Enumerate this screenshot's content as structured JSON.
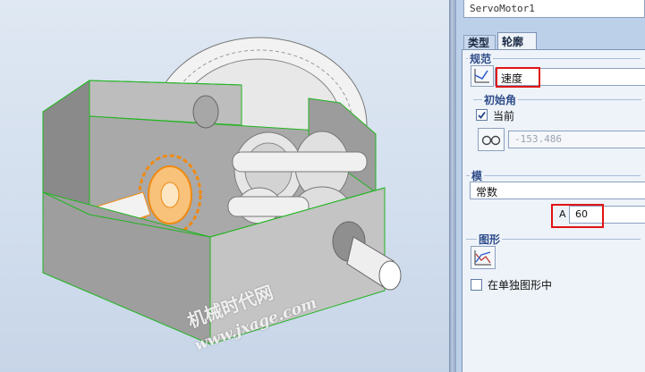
{
  "name_field": {
    "value": "ServoMotor1"
  },
  "tabs": [
    {
      "label": "类型",
      "active": false
    },
    {
      "label": "轮廓",
      "active": true
    }
  ],
  "spec_group": {
    "title": "规范",
    "spec_select": {
      "value": "速度"
    },
    "initial_angle": {
      "title": "初始角",
      "current_label": "当前",
      "current_checked": true,
      "angle_value": "-153.486"
    }
  },
  "model_group": {
    "title": "模",
    "model_select": {
      "value": "常数"
    },
    "param_label": "A",
    "param_value": "60"
  },
  "graph_group": {
    "title": "图形",
    "separate_label": "在单独图形中",
    "separate_checked": false
  },
  "icons": {
    "spec_icon": "motion-profile-icon",
    "glasses_icon": "glasses-icon",
    "graph_icon": "graph-icon"
  },
  "watermark": {
    "line1": "机械时代网",
    "line2": "www.jxage.com"
  },
  "colors": {
    "highlight_box": "#e01414",
    "selected_gear": "#f08a10",
    "frame_edges": "#22b522",
    "panel_bg": "#bcd0ea",
    "group_title": "#2f4d8a"
  }
}
